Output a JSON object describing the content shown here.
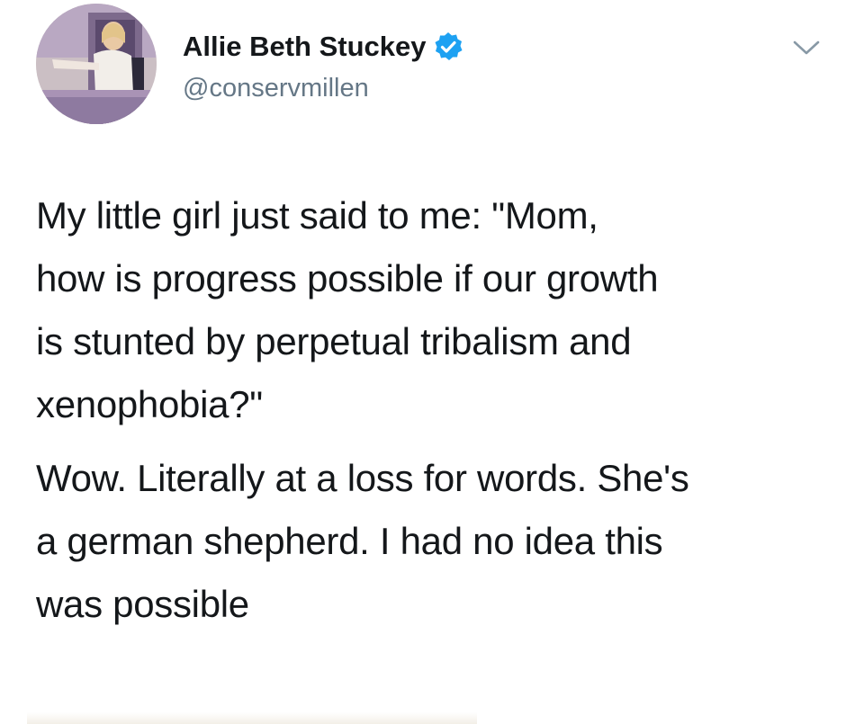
{
  "tweet": {
    "author": {
      "display_name": "Allie Beth Stuckey",
      "handle": "@conservmillen",
      "verified": true,
      "verified_icon": "verified-badge-icon",
      "verified_color": "#1da1f2",
      "avatar_icon": "profile-photo"
    },
    "menu_icon": "chevron-down-icon",
    "paragraphs": [
      "My little girl just said to me: \"Mom,\nhow is progress possible if our growth\nis stunted by perpetual tribalism and\nxenophobia?\"",
      "Wow. Literally at a loss for words. She's\na german shepherd. I had no idea this\nwas possible"
    ],
    "colors": {
      "text": "#14171a",
      "secondary_text": "#657786",
      "background": "#ffffff"
    }
  }
}
